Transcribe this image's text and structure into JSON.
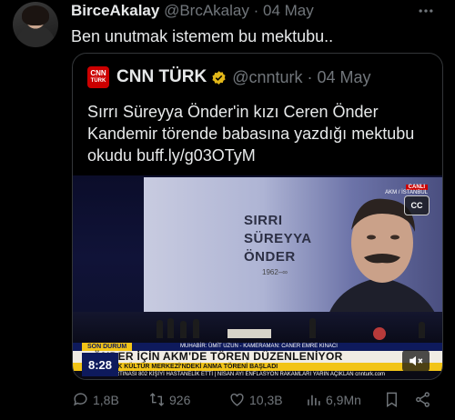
{
  "author": {
    "display_name": "BirceAkalay",
    "handle": "@BrcAkalay",
    "date": "· 04 May",
    "more_icon": "more-dots-icon"
  },
  "tweet": {
    "text": "Ben unutmak istemem bu mektubu.."
  },
  "quoted": {
    "logo_top": "CNN",
    "logo_bottom": "TÜRK",
    "display_name": "CNN TÜRK",
    "verified_icon": "verified-badge-icon",
    "handle": "@cnnturk · 04 May",
    "text": "Sırrı Süreyya Önder'in kızı Ceren Önder Kandemir törende babasına yazdığı mektubu okudu buff.ly/g03OTyM",
    "video": {
      "screen_name_line1": "SIRRI",
      "screen_name_line2": "SÜREYYA",
      "screen_name_line3": "ÖNDER",
      "screen_years": "1962–∞",
      "live_label": "CANLI",
      "live_location": "AKM / İSTANBUL",
      "cc_label": "CC",
      "son_durum": "SON DURUM",
      "credit": "MUHABİR: ÜMİT UZUN - KAMERAMAN: CANER EMRE KINACI",
      "headline": "ÖNDER İÇİN AKM'DE TÖREN DÜZENLENİYOR",
      "subheadline": "ATATÜRK KÜLTÜR MERKEZİ'NDEKİ ANMA TÖRENİ BAŞLADI",
      "ticker": "11:08 ● FIRTINASI 802 KİŞİYİ HASTANELİK ETTİ   |   NİSAN AYI ENFLASYON RAKAMLARI YARIN AÇIKLAN  cnnturk.com",
      "time": "8:28"
    }
  },
  "actions": {
    "reply_count": "1,8B",
    "retweet_count": "926",
    "like_count": "10,3B",
    "views_count": "6,9Mn"
  },
  "colors": {
    "background": "#000000",
    "text": "#e7e9ea",
    "muted": "#71767b",
    "border": "#333639",
    "cnn_red": "#cc0000",
    "verified_gold": "#e2b719"
  }
}
